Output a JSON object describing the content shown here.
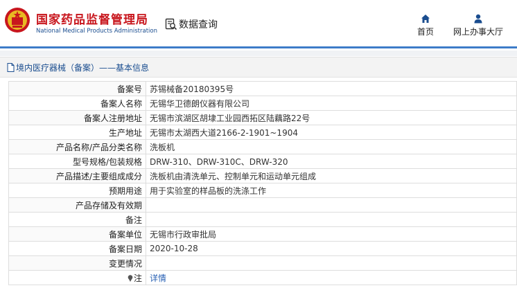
{
  "header": {
    "site_title": "国家药品监督管理局",
    "site_subtitle": "National Medical Products Administration",
    "query_label": "数据查询",
    "nav": [
      {
        "label": "首页",
        "icon": "home-icon"
      },
      {
        "label": "网上办事大厅",
        "icon": "user-icon"
      }
    ]
  },
  "breadcrumb": {
    "text": "境内医疗器械（备案）——基本信息",
    "icon": "document-icon"
  },
  "record": {
    "rows": [
      {
        "label": "备案号",
        "value": "苏锡械备20180395号"
      },
      {
        "label": "备案人名称",
        "value": "无锡华卫德朗仪器有限公司"
      },
      {
        "label": "备案人注册地址",
        "value": "无锡市滨湖区胡埭工业园西拓区陆藕路22号"
      },
      {
        "label": "生产地址",
        "value": "无锡市太湖西大道2166-2-1901~1904"
      },
      {
        "label": "产品名称/产品分类名称",
        "value": "洗板机"
      },
      {
        "label": "型号规格/包装规格",
        "value": "DRW-310、DRW-310C、DRW-320"
      },
      {
        "label": "产品描述/主要组成成分",
        "value": "洗板机由清洗单元、控制单元和运动单元组成"
      },
      {
        "label": "预期用途",
        "value": "用于实验室的样品板的洗涤工作"
      },
      {
        "label": "产品存储及有效期",
        "value": ""
      },
      {
        "label": "备注",
        "value": ""
      },
      {
        "label": "备案单位",
        "value": "无锡市行政审批局"
      },
      {
        "label": "备案日期",
        "value": "2020-10-28"
      },
      {
        "label": "变更情况",
        "value": ""
      }
    ],
    "note_label": "注",
    "note_link": "详情"
  },
  "colors": {
    "brand_red": "#c8161d",
    "brand_blue": "#1a4d8f",
    "link_blue": "#2a62b4"
  }
}
